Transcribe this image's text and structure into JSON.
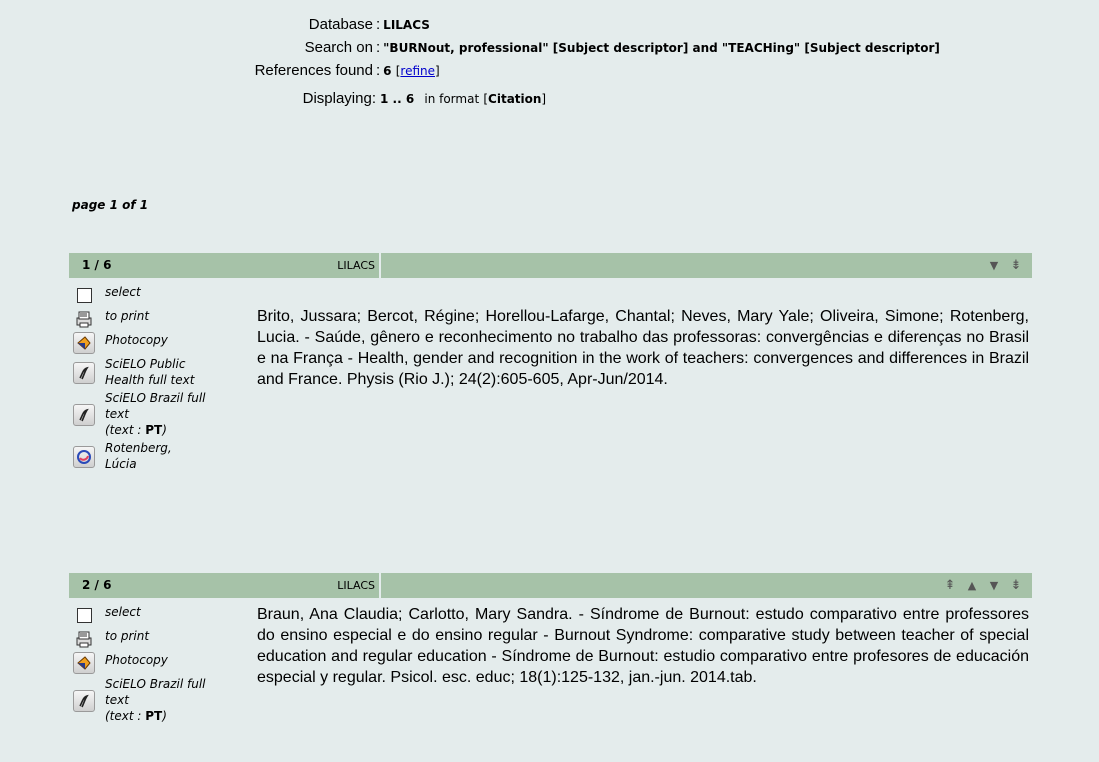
{
  "summary": {
    "database_label": "Database",
    "database_value": "LILACS",
    "search_label": "Search on",
    "search_value": "\"BURNout, professional\" [Subject descriptor] and \"TEACHing\" [Subject descriptor]",
    "refs_label": "References found",
    "refs_count": "6",
    "refine_link": "refine",
    "display_label": "Displaying:",
    "display_range": "1 .. 6",
    "display_format_prefix": "in format",
    "display_format": "Citation"
  },
  "page_info": "page 1 of 1",
  "records": [
    {
      "number": "1 / 6",
      "database": "LILACS",
      "actions": {
        "select": "select",
        "print": "to print",
        "photocopy": "Photocopy",
        "scielo_public": "SciELO Public Health full text",
        "scielo_brazil": "SciELO Brazil full text",
        "text_lang_prefix": "(text : ",
        "text_lang": "PT",
        "text_lang_suffix": ")",
        "author_link": "Rotenberg, Lúcia"
      },
      "citation": "Brito, Jussara; Bercot, Régine; Horellou-Lafarge, Chantal; Neves, Mary Yale; Oliveira, Simone; Rotenberg, Lucia. - Saúde, gênero e reconhecimento no trabalho das professoras: convergências e diferenças no Brasil e na França - Health, gender and recognition in the work of teachers: convergences and differences in Brazil and France. Physis (Rio J.); 24(2):605-605, Apr-Jun/2014."
    },
    {
      "number": "2 / 6",
      "database": "LILACS",
      "actions": {
        "select": "select",
        "print": "to print",
        "photocopy": "Photocopy",
        "scielo_brazil": "SciELO Brazil full text",
        "text_lang_prefix": "(text : ",
        "text_lang": "PT",
        "text_lang_suffix": ")"
      },
      "citation": "Braun, Ana Claudia; Carlotto, Mary Sandra. - Síndrome de Burnout: estudo comparativo entre professores do ensino especial e do ensino regular - Burnout Syndrome: comparative study between teacher of special education and regular education - Síndrome de Burnout: estudio comparativo entre profesores de educación especial y regular. Psicol. esc. educ; 18(1):125-132, jan.-jun. 2014.tab."
    }
  ],
  "icons": {
    "printer": "printer-icon",
    "photocopy": "photocopy-icon",
    "fulltext": "fulltext-icon",
    "author": "author-cv-icon",
    "nav_first": "first-record-icon",
    "nav_prev": "previous-record-icon",
    "nav_next": "next-record-icon",
    "nav_last": "last-record-icon"
  },
  "colors": {
    "background": "#e4ecec",
    "record_header": "#a6c2a8",
    "link": "#0000cc"
  }
}
